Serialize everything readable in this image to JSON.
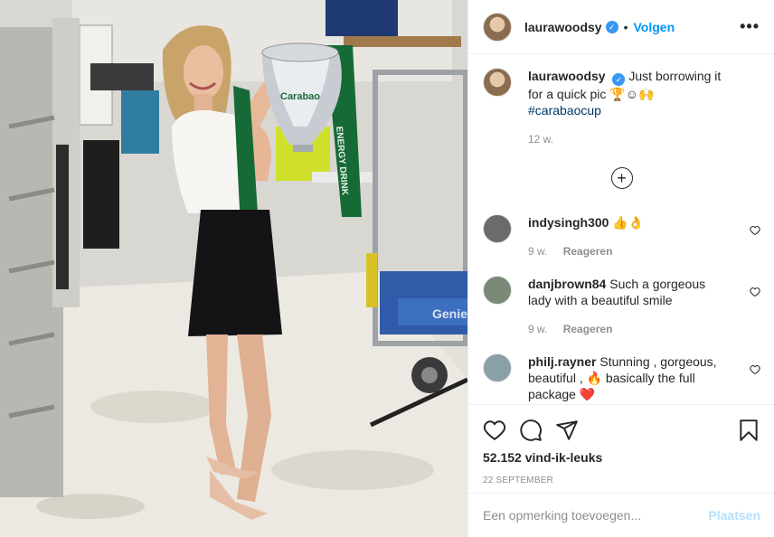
{
  "post": {
    "username": "laurawoodsy",
    "follow_label": "Volgen",
    "more_label": "•••",
    "caption": {
      "username": "laurawoodsy",
      "text": "Just borrowing it for a quick pic 🏆☺🙌",
      "hashtag": "#carabaocup",
      "time": "12 w."
    },
    "load_more_label": "+",
    "comments": [
      {
        "username": "indysingh300",
        "text": "👍👌",
        "time": "9 w.",
        "reply_label": "Reageren",
        "avatar_color": "#6b6b6b"
      },
      {
        "username": "danjbrown84",
        "text": "Such a gorgeous lady with a beautiful smile",
        "time": "9 w.",
        "reply_label": "Reageren",
        "avatar_color": "#7a8a77"
      },
      {
        "username": "philj.rayner",
        "text": "Stunning , gorgeous, beautiful , 🔥 basically the full package ❤️",
        "avatar_color": "#8aa0a8"
      }
    ],
    "likes": "52.152 vind-ik-leuks",
    "date": "22 SEPTEMBER",
    "comment_placeholder": "Een opmerking toevoegen...",
    "post_label": "Plaatsen"
  },
  "photo_content": {
    "trophy_label": "Carabao",
    "ribbon_text": "ENERGY DRINK",
    "box_label": "Genie"
  },
  "colors": {
    "accent_blue": "#0095f6",
    "post_disabled": "#b2dffc",
    "muted": "#8e8e8e"
  }
}
